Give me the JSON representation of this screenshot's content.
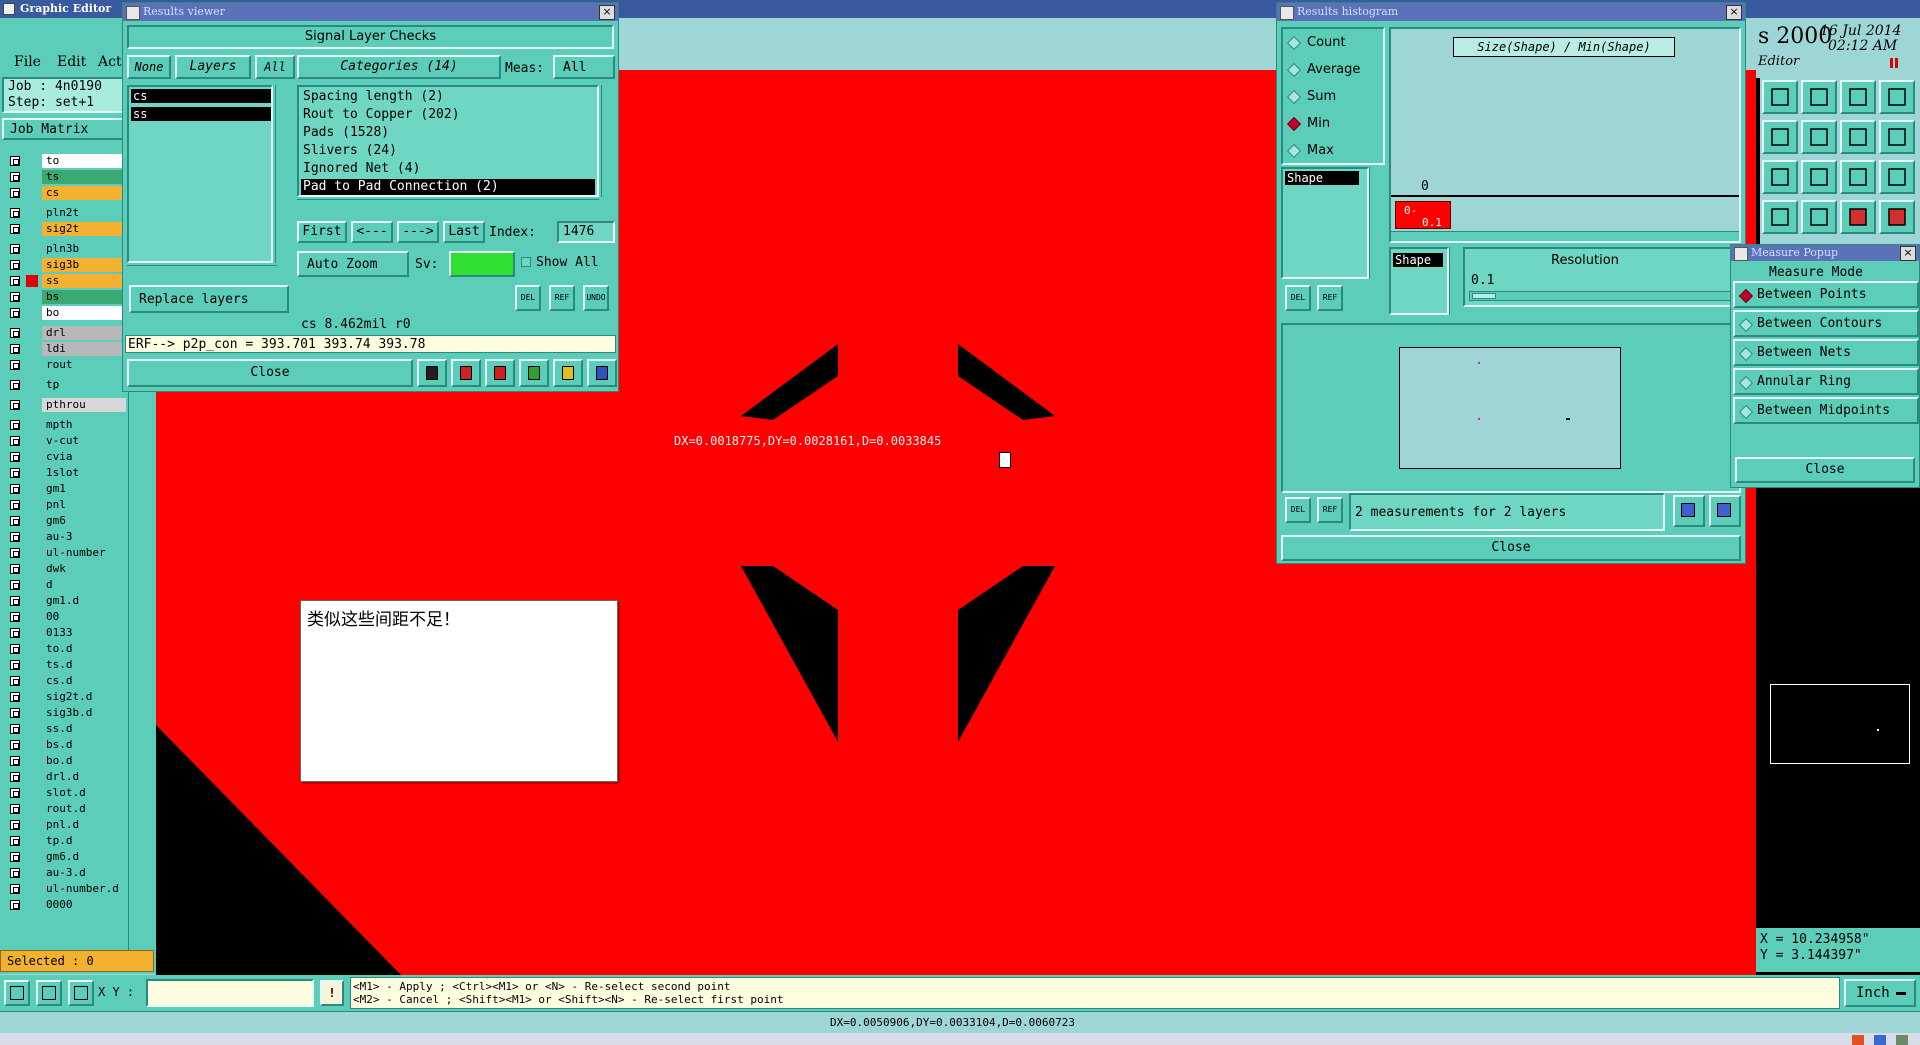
{
  "app": {
    "title": "Graphic Editor",
    "menu": [
      "File",
      "Edit",
      "Act"
    ],
    "job": "Job : 4n0190",
    "step": "Step: set+1",
    "job_matrix": "Job Matrix",
    "selected": "Selected : 0",
    "license": "s 2000",
    "date": "16 Jul 2014",
    "time": "02:12 AM",
    "editor": "Editor",
    "coord_x": "X = 10.234958\"",
    "coord_y": "Y = 3.144397\"",
    "units": "Inch",
    "xy_label": "X Y :",
    "xy_value": "",
    "hint_line1": "<M1> - Apply  ; <Ctrl><M1> or <N> - Re-select second point",
    "hint_line2": "<M2> - Cancel ; <Shift><M1> or <Shift><N> - Re-select first point",
    "status": "DX=0.0050906,DY=0.0033104,D=0.0060723"
  },
  "layers": [
    {
      "name": "to",
      "color": "#ffffff"
    },
    {
      "name": "ts",
      "color": "#3aa870"
    },
    {
      "name": "cs",
      "color": "#f4b030"
    },
    {
      "name": "pln2t",
      "color": "#5ccdb8"
    },
    {
      "name": "sig2t",
      "color": "#f4b030"
    },
    {
      "name": "pln3b",
      "color": "#5ccdb8"
    },
    {
      "name": "sig3b",
      "color": "#f4b030"
    },
    {
      "name": "ss",
      "color": "#f4b030"
    },
    {
      "name": "bs",
      "color": "#3aa870"
    },
    {
      "name": "bo",
      "color": "#ffffff"
    },
    {
      "name": "drl",
      "color": "#b8b8b8"
    },
    {
      "name": "ldi",
      "color": "#b8b8b8"
    },
    {
      "name": "rout",
      "color": "#5ccdb8"
    },
    {
      "name": "tp",
      "color": "#5ccdb8"
    },
    {
      "name": "pthrou",
      "color": "#d8d8d8"
    },
    {
      "name": "mpth",
      "color": "#5ccdb8"
    },
    {
      "name": "v-cut",
      "color": "#5ccdb8"
    },
    {
      "name": "cvia",
      "color": "#5ccdb8"
    },
    {
      "name": "1slot",
      "color": "#5ccdb8"
    },
    {
      "name": "gm1",
      "color": "#5ccdb8"
    },
    {
      "name": "pnl",
      "color": "#5ccdb8"
    },
    {
      "name": "gm6",
      "color": "#5ccdb8"
    },
    {
      "name": "au-3",
      "color": "#5ccdb8"
    },
    {
      "name": "ul-number",
      "color": "#5ccdb8"
    },
    {
      "name": "dwk",
      "color": "#5ccdb8"
    },
    {
      "name": "d",
      "color": "#5ccdb8"
    },
    {
      "name": "gm1.d",
      "color": "#5ccdb8"
    },
    {
      "name": "00",
      "color": "#5ccdb8"
    },
    {
      "name": "0133",
      "color": "#5ccdb8"
    },
    {
      "name": "to.d",
      "color": "#5ccdb8"
    },
    {
      "name": "ts.d",
      "color": "#5ccdb8"
    },
    {
      "name": "cs.d",
      "color": "#5ccdb8"
    },
    {
      "name": "sig2t.d",
      "color": "#5ccdb8"
    },
    {
      "name": "sig3b.d",
      "color": "#5ccdb8"
    },
    {
      "name": "ss.d",
      "color": "#5ccdb8"
    },
    {
      "name": "bs.d",
      "color": "#5ccdb8"
    },
    {
      "name": "bo.d",
      "color": "#5ccdb8"
    },
    {
      "name": "drl.d",
      "color": "#5ccdb8"
    },
    {
      "name": "slot.d",
      "color": "#5ccdb8"
    },
    {
      "name": "rout.d",
      "color": "#5ccdb8"
    },
    {
      "name": "pnl.d",
      "color": "#5ccdb8"
    },
    {
      "name": "tp.d",
      "color": "#5ccdb8"
    },
    {
      "name": "gm6.d",
      "color": "#5ccdb8"
    },
    {
      "name": "au-3.d",
      "color": "#5ccdb8"
    },
    {
      "name": "ul-number.d",
      "color": "#5ccdb8"
    },
    {
      "name": "0000",
      "color": "#5ccdb8"
    }
  ],
  "results_viewer": {
    "title": "Results viewer",
    "header": "Signal Layer Checks",
    "none": "None",
    "layers_tab": "Layers",
    "all": "All",
    "layer_items": [
      "cs",
      "ss"
    ],
    "categories_tab": "Categories (14)",
    "meas_label": "Meas:",
    "meas_value": "All",
    "categories": [
      "Spacing length (2)",
      "Rout to Copper (202)",
      "Pads (1528)",
      "Slivers (24)",
      "Ignored Net (4)",
      "Pad to Pad Connection (2)"
    ],
    "first": "First",
    "prev": "<---",
    "next": "--->",
    "last": "Last",
    "index_label": "Index:",
    "index_value": "1476",
    "auto_zoom": "Auto Zoom",
    "sv_label": "Sv:",
    "show_all": "Show All",
    "replace_layers": "Replace layers",
    "info": "cs 8.462mil  r0",
    "erf": "ERF--> p2p_con = 393.701 393.74 393.78",
    "close": "Close",
    "del": "DEL",
    "ref": "REF",
    "undo": "UNDO"
  },
  "histogram": {
    "title": "Results histogram",
    "modes": [
      "Count",
      "Average",
      "Sum",
      "Min",
      "Max"
    ],
    "selected_mode": "Min",
    "plot_title": "Size(Shape) / Min(Shape)",
    "axis_zero": "0",
    "bin_label_top": "0-",
    "bin_label_bottom": "0.1",
    "shape_label": "Shape",
    "shape_label2": "Shape",
    "resolution_label": "Resolution",
    "resolution_value": "0.1",
    "summary": "2 measurements for 2 layers",
    "close": "Close",
    "del": "DEL",
    "ref": "REF"
  },
  "measure_popup": {
    "title": "Measure Popup",
    "mode_label": "Measure Mode",
    "modes": [
      "Between Points",
      "Between Contours",
      "Between Nets",
      "Annular Ring",
      "Between Midpoints"
    ],
    "selected_mode": "Between Points",
    "close": "Close"
  },
  "canvas": {
    "measure_text": "DX=0.0018775,DY=0.0028161,D=0.0033845",
    "note": "类似这些间距不足！"
  }
}
